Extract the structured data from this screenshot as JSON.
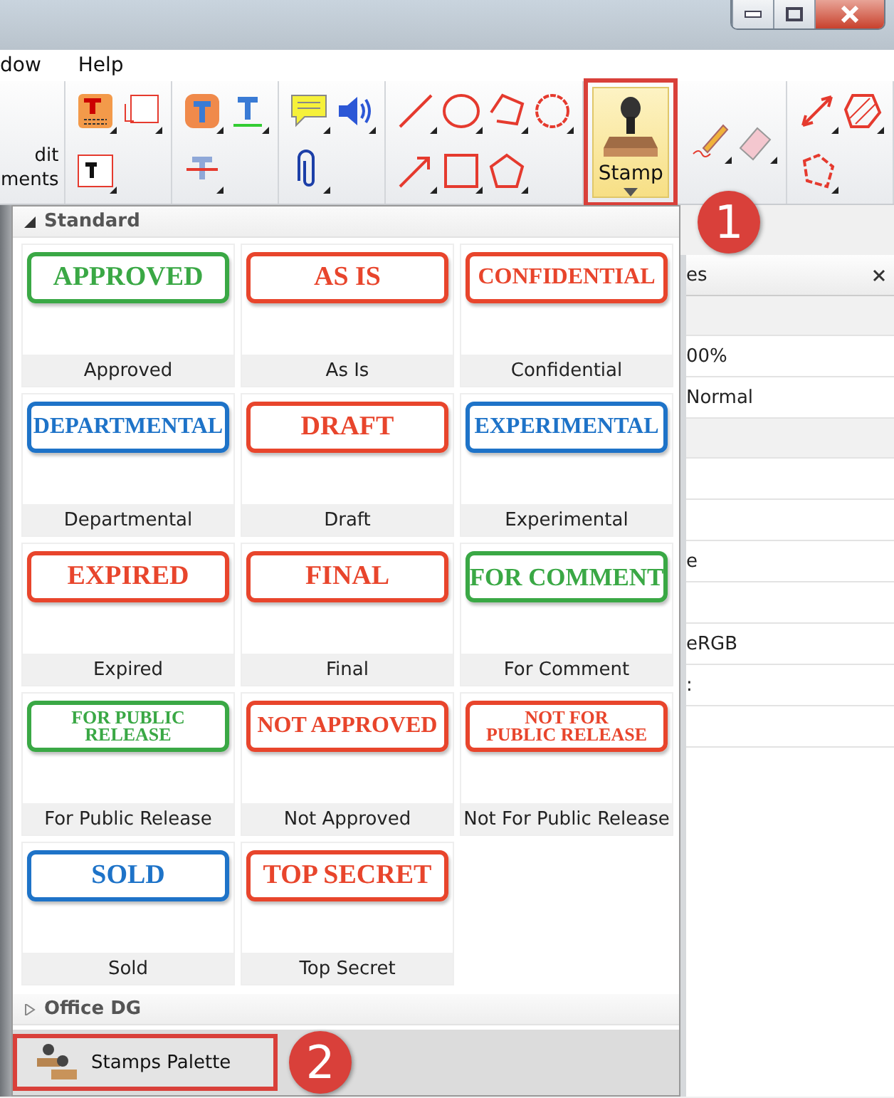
{
  "window_controls": {
    "close_active": true
  },
  "menu": [
    {
      "label": "dow"
    },
    {
      "label": "Help"
    }
  ],
  "toolbar": {
    "edit_label": [
      "dit",
      "ments"
    ],
    "stamp_button": {
      "label": "Stamp",
      "highlighted": true
    }
  },
  "callouts": [
    {
      "number": "1"
    },
    {
      "number": "2"
    }
  ],
  "palette": {
    "groups": [
      {
        "name": "Standard",
        "expanded": true,
        "stamps": [
          {
            "label": "Approved",
            "stamp_lines": [
              "APPROVED"
            ],
            "color": "#3aa845"
          },
          {
            "label": "As Is",
            "stamp_lines": [
              "AS IS"
            ],
            "color": "#e8452c"
          },
          {
            "label": "Confidential",
            "stamp_lines": [
              "CONFIDENTIAL"
            ],
            "color": "#e8452c"
          },
          {
            "label": "Departmental",
            "stamp_lines": [
              "DEPARTMENTAL"
            ],
            "color": "#1e73c8"
          },
          {
            "label": "Draft",
            "stamp_lines": [
              "DRAFT"
            ],
            "color": "#e8452c"
          },
          {
            "label": "Experimental",
            "stamp_lines": [
              "EXPERIMENTAL"
            ],
            "color": "#1e73c8"
          },
          {
            "label": "Expired",
            "stamp_lines": [
              "EXPIRED"
            ],
            "color": "#e8452c"
          },
          {
            "label": "Final",
            "stamp_lines": [
              "FINAL"
            ],
            "color": "#e8452c"
          },
          {
            "label": "For Comment",
            "stamp_lines": [
              "FOR COMMENT"
            ],
            "color": "#3aa845"
          },
          {
            "label": "For Public Release",
            "stamp_lines": [
              "FOR PUBLIC",
              "RELEASE"
            ],
            "color": "#3aa845"
          },
          {
            "label": "Not Approved",
            "stamp_lines": [
              "NOT APPROVED"
            ],
            "color": "#e8452c"
          },
          {
            "label": "Not For Public Release",
            "stamp_lines": [
              "NOT FOR",
              "PUBLIC RELEASE"
            ],
            "color": "#e8452c"
          },
          {
            "label": "Sold",
            "stamp_lines": [
              "SOLD"
            ],
            "color": "#1e73c8"
          },
          {
            "label": "Top Secret",
            "stamp_lines": [
              "TOP SECRET"
            ],
            "color": "#e8452c"
          }
        ]
      },
      {
        "name": "Office DG",
        "expanded": false
      }
    ],
    "footer_button": {
      "label": "Stamps Palette",
      "highlighted": true
    }
  },
  "properties_panel": {
    "title": "es",
    "rows": [
      {
        "kind": "section"
      },
      {
        "kind": "row",
        "value": "00%"
      },
      {
        "kind": "row",
        "value": "Normal"
      },
      {
        "kind": "section"
      },
      {
        "kind": "row"
      },
      {
        "kind": "row"
      },
      {
        "kind": "row",
        "value": "e"
      },
      {
        "kind": "row"
      },
      {
        "kind": "row",
        "value": "eRGB"
      },
      {
        "kind": "row",
        "value": ":"
      },
      {
        "kind": "row"
      }
    ]
  }
}
